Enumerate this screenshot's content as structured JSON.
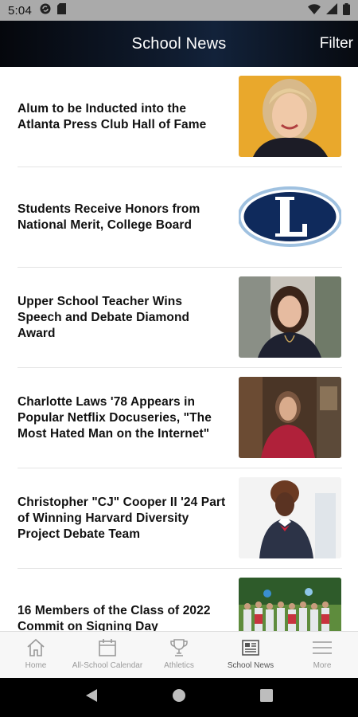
{
  "status_bar": {
    "time": "5:04",
    "icons": [
      "sync-icon",
      "sd-card-icon",
      "wifi-icon",
      "signal-icon",
      "battery-icon"
    ]
  },
  "header": {
    "title": "School News",
    "filter_label": "Filter"
  },
  "news": [
    {
      "headline": "Alum to be Inducted into the Atlanta Press Club Hall of Fame",
      "thumbnail": "woman-portrait-photo"
    },
    {
      "headline": "Students Receive Honors from National Merit, College Board",
      "thumbnail": "school-L-logo"
    },
    {
      "headline": "Upper School Teacher Wins Speech and Debate Diamond Award",
      "thumbnail": "teacher-portrait-photo"
    },
    {
      "headline": "Charlotte Laws '78 Appears in Popular Netflix Docuseries, \"The Most Hated Man on the Internet\"",
      "thumbnail": "interview-still-photo"
    },
    {
      "headline": "Christopher \"CJ\" Cooper II '24 Part of Winning Harvard Diversity Project Debate Team",
      "thumbnail": "student-portrait-photo"
    },
    {
      "headline": "16 Members of the Class of 2022 Commit on Signing Day",
      "thumbnail": "group-photo"
    }
  ],
  "tabs": [
    {
      "label": "Home",
      "icon": "home-icon",
      "active": false
    },
    {
      "label": "All-School Calendar",
      "icon": "calendar-icon",
      "active": false
    },
    {
      "label": "Athletics",
      "icon": "trophy-icon",
      "active": false
    },
    {
      "label": "School News",
      "icon": "newspaper-icon",
      "active": true
    },
    {
      "label": "More",
      "icon": "menu-icon",
      "active": false
    }
  ],
  "colors": {
    "header_dark": "#05070c",
    "header_navy": "#12223a",
    "logo_navy": "#0f2a5c",
    "tab_inactive": "#9a9a9a",
    "tab_active": "#555555"
  }
}
